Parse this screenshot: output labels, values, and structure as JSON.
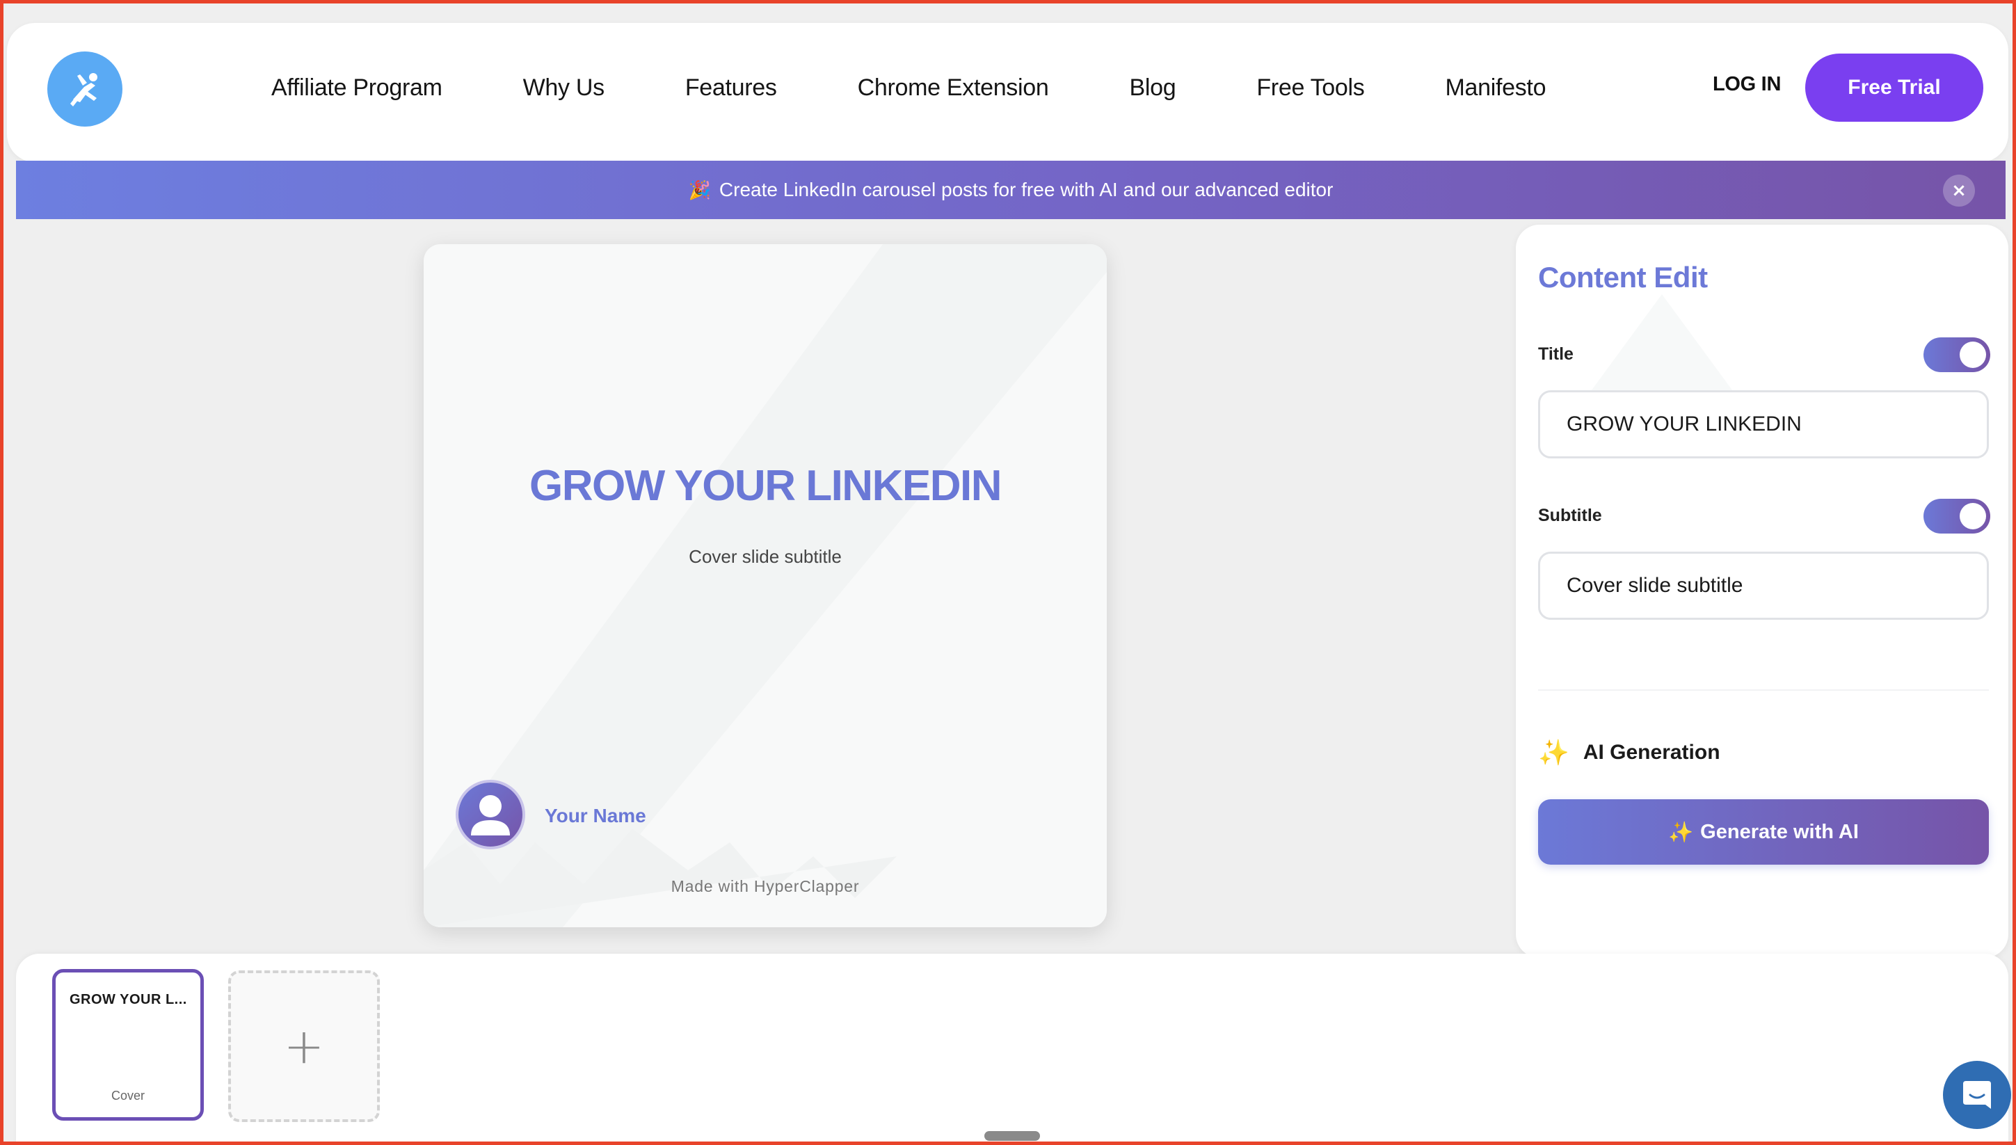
{
  "header": {
    "nav": [
      "Affiliate Program",
      "Why Us",
      "Features",
      "Chrome Extension",
      "Blog",
      "Free Tools",
      "Manifesto"
    ],
    "login_label": "LOG IN",
    "trial_label": "Free Trial"
  },
  "banner": {
    "emoji": "🎉",
    "text": "Create LinkedIn carousel posts for free with AI and our advanced editor",
    "close_label": "×"
  },
  "slide": {
    "title": "GROW YOUR LINKEDIN",
    "subtitle": "Cover slide subtitle",
    "author_name": "Your Name",
    "made_with": "Made with HyperClapper"
  },
  "panel": {
    "heading": "Content Edit",
    "title_label": "Title",
    "title_value": "GROW YOUR LINKEDIN",
    "title_toggle_on": true,
    "subtitle_label": "Subtitle",
    "subtitle_value": "Cover slide subtitle",
    "subtitle_toggle_on": true,
    "ai_sparkle": "✨",
    "ai_label": "AI Generation",
    "generate_sparkle": "✨",
    "generate_label": "Generate with AI"
  },
  "slides_strip": {
    "thumbs": [
      {
        "title": "GROW YOUR L...",
        "caption": "Cover"
      }
    ],
    "add_label": "+"
  },
  "colors": {
    "accent": "#6c79d7",
    "accent_dark": "#7654a8",
    "cta_purple": "#7a3ff0",
    "logo_blue": "#5aaaf4",
    "chat_blue": "#2f6db3",
    "frame_red": "#e8432a"
  },
  "icons": {
    "logo": "superhero-icon",
    "avatar": "user-icon",
    "chat": "chat-icon"
  }
}
